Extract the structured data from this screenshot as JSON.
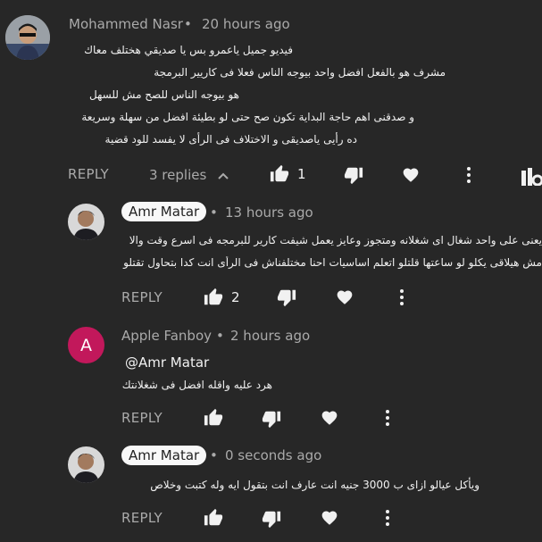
{
  "comment": {
    "author": "Mohammed Nasr",
    "time": "20 hours ago",
    "lines": [
      "فيديو جميل ياعمرو بس يا صديقي هختلف معاك",
      "مشرف هو بالفعل افضل واحد بيوجه الناس فعلا فى كاريير البرمجة",
      "هو بيوجه الناس للصح مش للسهل",
      "و صدقنى اهم حاجة البداية تكون صح حتى لو بطيئة افضل من سهلة وسريعة",
      "ده رأيى ياصديقى و الاختلاف فى الرأى لا يفسد للود قضية"
    ],
    "reply_label": "REPLY",
    "replies_label": "3 replies",
    "like_count": "1"
  },
  "replies": [
    {
      "author": "Amr Matar",
      "time": "13 hours ago",
      "lines": [
        "يعنى على واحد شغال اى شغلانه ومتجوز وعايز يعمل شيفت كارير للبرمجه فى اسرع وقت والا",
        "مش هيلاقى يكلو لو ساعتها قلتلو اتعلم اساسيات احنا مختلفناش فى الرأى انت كدا بتحاول تقتلو"
      ],
      "reply_label": "REPLY",
      "like_count": "2"
    },
    {
      "author": "Apple Fanboy",
      "avatar_letter": "A",
      "avatar_color": "#c2185b",
      "time": "2 hours ago",
      "mention": "@Amr Matar",
      "lines": [
        "هرد عليه واقله افضل فى شغلانتك"
      ],
      "reply_label": "REPLY"
    },
    {
      "author": "Amr Matar",
      "time": "0 seconds ago",
      "lines": [
        "ويأكل عيالو ازاى ب 3000 جنيه انت عارف انت بتقول ايه وله كتبت وخلاص"
      ],
      "reply_label": "REPLY"
    }
  ]
}
